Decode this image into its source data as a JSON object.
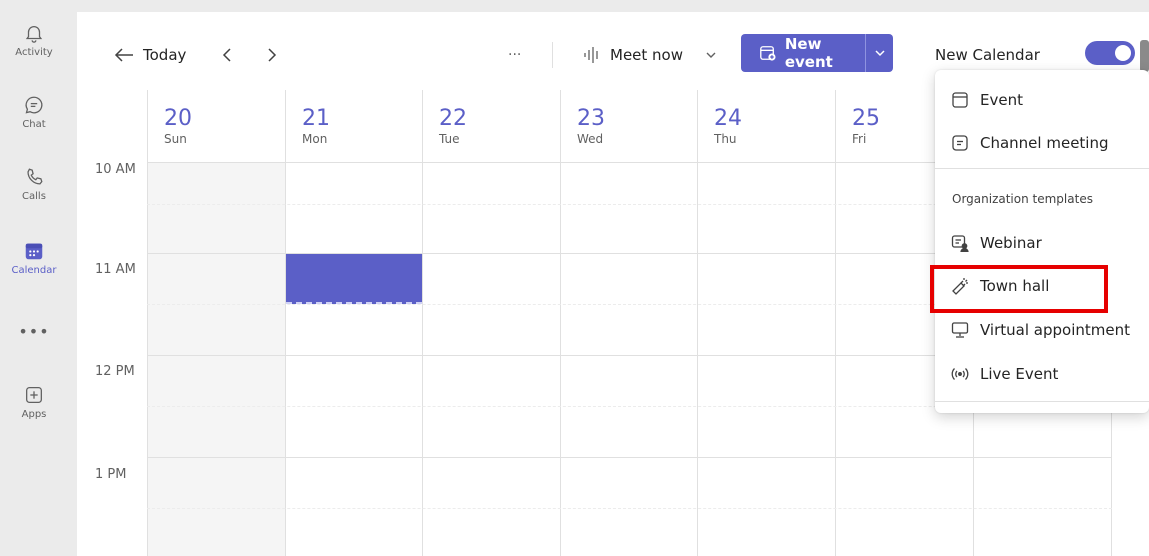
{
  "rail": {
    "items": [
      {
        "label": "Activity"
      },
      {
        "label": "Chat"
      },
      {
        "label": "Calls"
      },
      {
        "label": "Calendar"
      },
      {
        "label": "Apps"
      }
    ],
    "more": "•••"
  },
  "toolbar": {
    "today": "Today",
    "more": "···",
    "meet_now": "Meet now",
    "new_event": "New event",
    "new_calendar": "New Calendar"
  },
  "days": [
    {
      "num": "20",
      "dow": "Sun"
    },
    {
      "num": "21",
      "dow": "Mon"
    },
    {
      "num": "22",
      "dow": "Tue"
    },
    {
      "num": "23",
      "dow": "Wed"
    },
    {
      "num": "24",
      "dow": "Thu"
    },
    {
      "num": "25",
      "dow": "Fri"
    }
  ],
  "times": [
    "10 AM",
    "11 AM",
    "12 PM",
    "1 PM"
  ],
  "menu": {
    "event": "Event",
    "channel_meeting": "Channel meeting",
    "group_title": "Organization templates",
    "webinar": "Webinar",
    "town_hall": "Town hall",
    "virtual_appointment": "Virtual appointment",
    "live_event": "Live Event"
  },
  "colors": {
    "accent": "#5b5fc7",
    "highlight": "#e60000"
  }
}
